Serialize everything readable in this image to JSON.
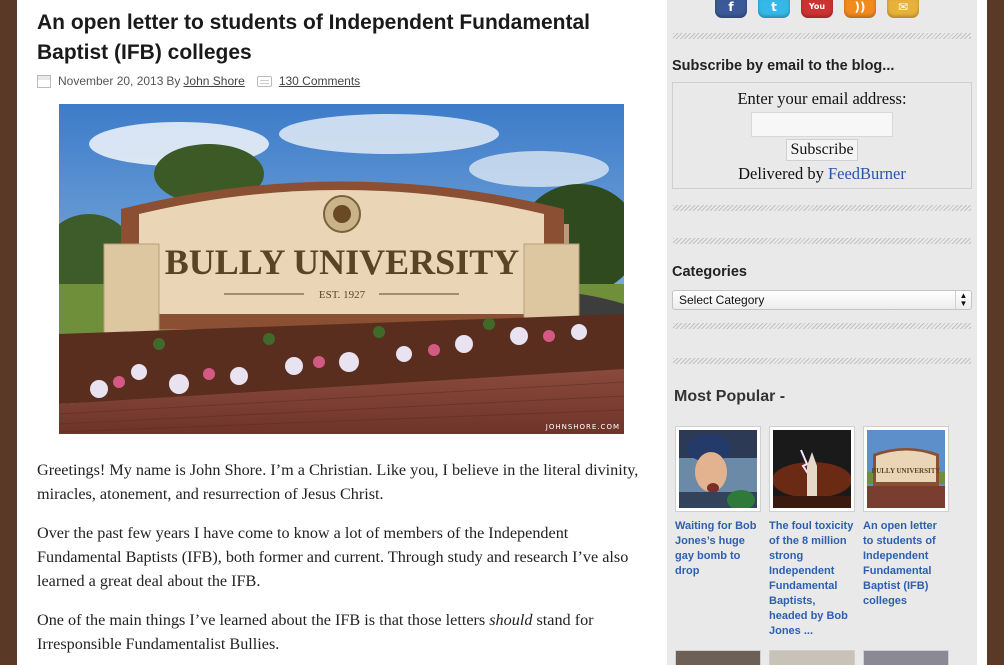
{
  "post": {
    "title": "An open letter to students of Independent Fundamental Baptist (IFB) colleges",
    "date": "November 20, 2013",
    "by": "By",
    "author": "John Shore",
    "comments": "130 Comments",
    "image": {
      "sign_text": "BULLY UNIVERSITY",
      "sign_subtext": "EST. 1927",
      "watermark": "JOHNSHORE.COM"
    },
    "paragraphs": [
      {
        "text": "Greetings! My name is John Shore. I’m a Christian. Like you, I believe in the literal divinity, miracles, atonement, and resurrection of Jesus Christ."
      },
      {
        "text": "Over the past few years I have come to know a lot of members of the Independent Fundamental Baptists (IFB), both former and current. Through study and research I’ve also learned a great deal about the IFB."
      },
      {
        "before": "One of the main things I’ve learned about the IFB is that those letters ",
        "emphasis": "should",
        "after": " stand for Irresponsible Fundamentalist Bullies."
      }
    ]
  },
  "sidebar": {
    "social": [
      {
        "name": "facebook-icon",
        "glyph": "f",
        "color": "#3b5998"
      },
      {
        "name": "twitter-icon",
        "glyph": "t",
        "color": "#35b8e8"
      },
      {
        "name": "youtube-icon",
        "glyph": "You",
        "color": "#c33"
      },
      {
        "name": "rss-icon",
        "glyph": "))",
        "color": "#f28a1e"
      },
      {
        "name": "email-icon",
        "glyph": "✉",
        "color": "#e8b23a"
      }
    ],
    "subscribe": {
      "title": "Subscribe by email to the blog...",
      "label": "Enter your email address:",
      "input_value": "",
      "button": "Subscribe",
      "delivered_by": "Delivered by",
      "feedburner": "FeedBurner"
    },
    "categories": {
      "title": "Categories",
      "selected": "Select Category"
    },
    "popular": {
      "title": "Most Popular -",
      "items": [
        {
          "title": "Waiting for Bob Jones’s huge gay bomb to drop"
        },
        {
          "title": "The foul toxicity of the 8 million strong Independent Fundamental Baptists, headed by Bob Jones ..."
        },
        {
          "title": "An open letter to students of Independent Fundamental Baptist (IFB) colleges",
          "thumb_sign": "BULLY UNIVERSITY"
        }
      ]
    }
  }
}
